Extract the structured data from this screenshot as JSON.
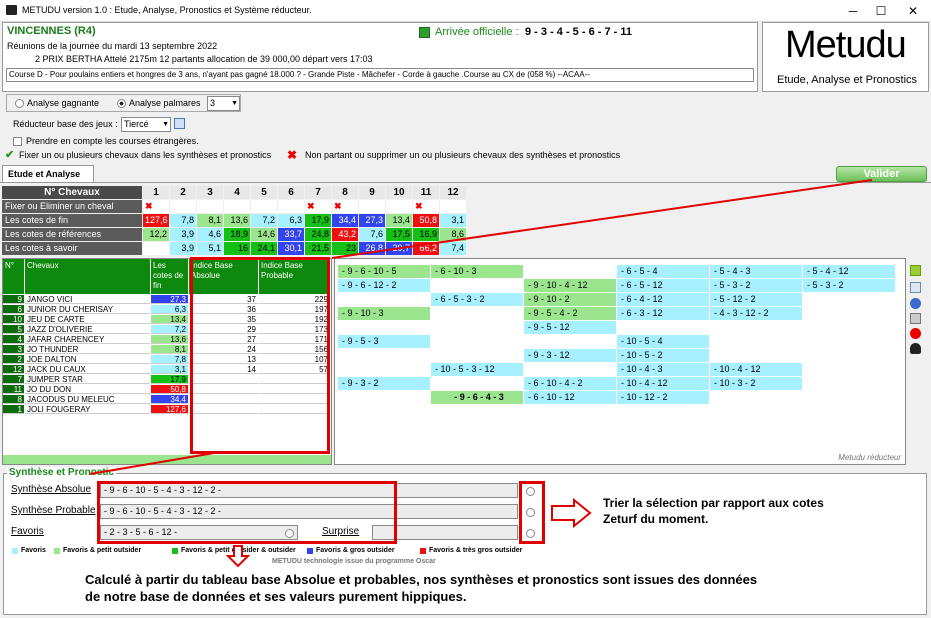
{
  "window": {
    "title": "METUDU version 1.0  : Etude, Analyse, Pronostics et Système réducteur.",
    "min": "─",
    "max": "☐",
    "close": "✕"
  },
  "header": {
    "hippodrome": "VINCENNES (R4)",
    "reunion": "Réunions de la journée du mardi 13 septembre 2022",
    "prix": "2 PRIX BERTHA Attelé 2175m 12 partants allocation de 39 000,00 départ vers 17:03",
    "course": "Course D - Pour poulains entiers et hongres de 3 ans, n'ayant pas gagné 18.000 ? - Grande Piste - Mâchefer - Corde à gauche .Course au CX de (058 %)  --ACAA--",
    "arrivee_label": "Arrivée officielle :",
    "arrivee": "9 - 3 - 4 - 5 - 6 - 7 - 11"
  },
  "logo": {
    "name": "Metudu",
    "sub": "Etude, Analyse et Pronostics"
  },
  "options": {
    "analyse_gagnante": "Analyse gagnante",
    "analyse_palmares": "Analyse palmares",
    "palmares_value": "3",
    "reducteur_label": "Réducteur base des jeux :",
    "reducteur_value": "Tiercé",
    "etrangeres": "Prendre en compte les courses étrangères.",
    "fixer": "Fixer un ou plusieurs chevaux dans les synthèses et pronostics",
    "non_partant": "Non partant ou supprimer un ou plusieurs chevaux des synthèses et pronostics"
  },
  "tab": "Etude et Analyse",
  "valider": "Valider",
  "top_table": {
    "header": "N° Chevaux",
    "numbers": [
      "1",
      "2",
      "3",
      "4",
      "5",
      "6",
      "7",
      "8",
      "9",
      "10",
      "11",
      "12"
    ],
    "row_labels": [
      "Fixer ou Eliminer un cheval",
      "Les cotes de fin",
      "Les cotes de références",
      "Les cotes à savoir"
    ],
    "marks": [
      "x",
      "",
      "",
      "",
      "",
      "",
      "x",
      "x",
      "",
      "",
      "x",
      ""
    ],
    "cotes_fin": [
      "127,6",
      "7,8",
      "8,1",
      "13,6",
      "7,2",
      "6,3",
      "17,9",
      "34,4",
      "27,3",
      "13,4",
      "50,8",
      "3,1"
    ],
    "cotes_ref": [
      "12,2",
      "3,9",
      "4,6",
      "18,9",
      "14,6",
      "33,7",
      "24,8",
      "43,2",
      "7,6",
      "17,5",
      "16,9",
      "8,6"
    ],
    "cotes_savoir": [
      "",
      "3,9",
      "5,1",
      "16",
      "24,1",
      "30,1",
      "21,5",
      "23",
      "26,8",
      "29,7",
      "66,2",
      "7,4"
    ]
  },
  "colors": {
    "light": "#a6f0ff",
    "green_light": "#9be58f",
    "green": "#13c013",
    "blue": "#3344ee",
    "red": "#ee1010",
    "accent_red": "#e00000",
    "tab_green": "#4caf50"
  },
  "horses": {
    "headers": [
      "N°",
      "Chevaux",
      "Les cotes de fin",
      "Indice Base Absolue",
      "Indice Base Probable"
    ],
    "rows": [
      {
        "n": "9",
        "name": "JANGO VICI",
        "cote": "27,3",
        "abs": "37",
        "prob": "229"
      },
      {
        "n": "6",
        "name": "JUNIOR DU CHERISAY",
        "cote": "6,3",
        "abs": "36",
        "prob": "197"
      },
      {
        "n": "10",
        "name": "JEU DE CARTE",
        "cote": "13,4",
        "abs": "35",
        "prob": "192"
      },
      {
        "n": "5",
        "name": "JAZZ D'OLIVERIE",
        "cote": "7,2",
        "abs": "29",
        "prob": "173"
      },
      {
        "n": "4",
        "name": "JAFAR CHARENCEY",
        "cote": "13,6",
        "abs": "27",
        "prob": "171"
      },
      {
        "n": "3",
        "name": "JO THUNDER",
        "cote": "8,1",
        "abs": "24",
        "prob": "156"
      },
      {
        "n": "2",
        "name": "JOE DALTON",
        "cote": "7,8",
        "abs": "13",
        "prob": "107"
      },
      {
        "n": "12",
        "name": "JACK DU CAUX",
        "cote": "3,1",
        "abs": "14",
        "prob": "57"
      },
      {
        "n": "7",
        "name": "JUMPER STAR",
        "cote": "17,9",
        "abs": "",
        "prob": ""
      },
      {
        "n": "11",
        "name": "JO DU DON",
        "cote": "50,8",
        "abs": "",
        "prob": ""
      },
      {
        "n": "8",
        "name": "JACODUS DU MELEUC",
        "cote": "34,4",
        "abs": "",
        "prob": ""
      },
      {
        "n": "1",
        "name": "JOLI FOUGERAY",
        "cote": "127,6",
        "abs": "",
        "prob": ""
      }
    ]
  },
  "combos": [
    {
      "t": "- 9 - 6 - 10 - 5",
      "c": "g"
    },
    {
      "t": "- 6 - 10 - 3",
      "c": "g"
    },
    {
      "t": "",
      "c": ""
    },
    {
      "t": "- 6 - 5 - 4",
      "c": "l"
    },
    {
      "t": "- 5 - 4 - 3",
      "c": "l"
    },
    {
      "t": "- 5 - 4 - 12",
      "c": "l"
    },
    {
      "t": "- 9 - 6 - 12 - 2",
      "c": "l"
    },
    {
      "t": "",
      "c": ""
    },
    {
      "t": "- 9 - 10 - 4 - 12",
      "c": "g"
    },
    {
      "t": "- 6 - 5 - 12",
      "c": "l"
    },
    {
      "t": "- 5 - 3 - 2",
      "c": "l"
    },
    {
      "t": "- 5 - 3 - 2",
      "c": "l"
    },
    {
      "t": "",
      "c": ""
    },
    {
      "t": "- 6 - 5 - 3 - 2",
      "c": "l"
    },
    {
      "t": "- 9 - 10 - 2",
      "c": "g"
    },
    {
      "t": "- 6 - 4 - 12",
      "c": "l"
    },
    {
      "t": "- 5 - 12 - 2",
      "c": "l"
    },
    {
      "t": "",
      "c": ""
    },
    {
      "t": "- 9 - 10 - 3",
      "c": "g"
    },
    {
      "t": "",
      "c": ""
    },
    {
      "t": "- 9 - 5 - 4 - 2",
      "c": "g"
    },
    {
      "t": "- 6 - 3 - 12",
      "c": "l"
    },
    {
      "t": "- 4 - 3 - 12 - 2",
      "c": "l"
    },
    {
      "t": "",
      "c": ""
    },
    {
      "t": "",
      "c": ""
    },
    {
      "t": "",
      "c": ""
    },
    {
      "t": "- 9 - 5 - 12",
      "c": "l"
    },
    {
      "t": "",
      "c": ""
    },
    {
      "t": "",
      "c": ""
    },
    {
      "t": "",
      "c": ""
    },
    {
      "t": "- 9 - 5 - 3",
      "c": "l"
    },
    {
      "t": "",
      "c": ""
    },
    {
      "t": "",
      "c": ""
    },
    {
      "t": "- 10 - 5 - 4",
      "c": "l"
    },
    {
      "t": "",
      "c": ""
    },
    {
      "t": "",
      "c": ""
    },
    {
      "t": "",
      "c": ""
    },
    {
      "t": "",
      "c": ""
    },
    {
      "t": "- 9 - 3 - 12",
      "c": "l"
    },
    {
      "t": "- 10 - 5 - 2",
      "c": "l"
    },
    {
      "t": "",
      "c": ""
    },
    {
      "t": "",
      "c": ""
    },
    {
      "t": "",
      "c": ""
    },
    {
      "t": "- 10 - 5 - 3 - 12",
      "c": "l"
    },
    {
      "t": "",
      "c": ""
    },
    {
      "t": "- 10 - 4 - 3",
      "c": "l"
    },
    {
      "t": "- 10 - 4 - 12",
      "c": "l"
    },
    {
      "t": "",
      "c": ""
    },
    {
      "t": "- 9 - 3 - 2",
      "c": "l"
    },
    {
      "t": "",
      "c": ""
    },
    {
      "t": "- 6 - 10 - 4 - 2",
      "c": "l"
    },
    {
      "t": "- 10 - 4 - 12",
      "c": "l"
    },
    {
      "t": "- 10 - 3 - 2",
      "c": "l"
    },
    {
      "t": "",
      "c": ""
    },
    {
      "t": "",
      "c": ""
    },
    {
      "t": "- 9 - 6 - 4 - 3",
      "c": "gb"
    },
    {
      "t": "- 6 - 10 - 12",
      "c": "l"
    },
    {
      "t": "- 10 - 12 - 2",
      "c": "l"
    },
    {
      "t": "",
      "c": ""
    },
    {
      "t": "",
      "c": ""
    }
  ],
  "reducteur_caption": "Metudu réducteur",
  "synthese": {
    "title": "Synthèse et Pronostic",
    "absolue_label": "Synthèse Absolue",
    "absolue": "- 9 - 6 - 10 - 5 - 4 - 3 - 12 - 2 -",
    "probable_label": "Synthèse Probable",
    "probable": "- 9 - 6 - 10 - 5 - 4 - 3 - 12 - 2 -",
    "favoris_label": "Favoris",
    "favoris": "- 2 - 3 - 5 - 6 - 12 -",
    "surprise_label": "Surprise"
  },
  "legend": [
    "Favoris",
    "Favoris & petit outsider",
    "Favoris & petit outsider & outsider",
    "Favoris & gros outsider",
    "Favoris & très gros outsider"
  ],
  "footer": "METUDU technologie issue du programme Oscar",
  "annotations": {
    "trier": "Trier la sélection par rapport aux cotes Zeturf du moment.",
    "calcule": "Calculé à partir du tableau base Absolue et probables, nos synthèses et pronostics sont issues des données de notre base de données et ses valeurs purement hippiques."
  }
}
